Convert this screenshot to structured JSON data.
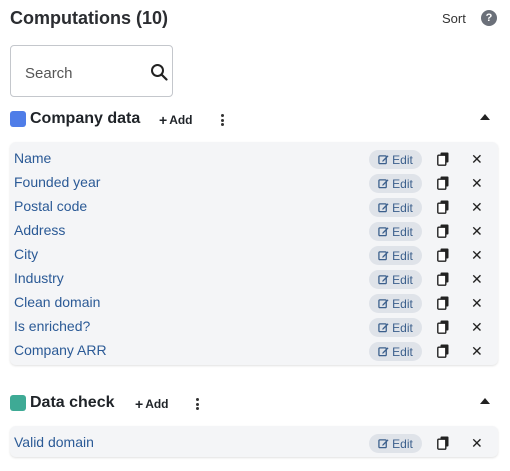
{
  "header": {
    "title": "Computations (10)",
    "sort_label": "Sort",
    "help_glyph": "?"
  },
  "search": {
    "placeholder": "Search",
    "value": ""
  },
  "groups": [
    {
      "title": "Company data",
      "color": "#4f7de8",
      "add_label": "Add",
      "items": [
        {
          "name": "Name",
          "edit_label": "Edit"
        },
        {
          "name": "Founded year",
          "edit_label": "Edit"
        },
        {
          "name": "Postal code",
          "edit_label": "Edit"
        },
        {
          "name": "Address",
          "edit_label": "Edit"
        },
        {
          "name": "City",
          "edit_label": "Edit"
        },
        {
          "name": "Industry",
          "edit_label": "Edit"
        },
        {
          "name": "Clean domain",
          "edit_label": "Edit"
        },
        {
          "name": "Is enriched?",
          "edit_label": "Edit"
        },
        {
          "name": "Company ARR",
          "edit_label": "Edit"
        }
      ]
    },
    {
      "title": "Data check",
      "color": "#3eaa95",
      "add_label": "Add",
      "items": [
        {
          "name": "Valid domain",
          "edit_label": "Edit"
        }
      ]
    }
  ],
  "icons": {
    "help": "help-circle-icon",
    "search": "magnifier-icon",
    "add": "plus-icon",
    "menu": "kebab-menu-icon",
    "collapse": "chevron-up-icon",
    "edit": "pencil-square-icon",
    "copy": "copy-icon",
    "delete": "close-icon"
  }
}
